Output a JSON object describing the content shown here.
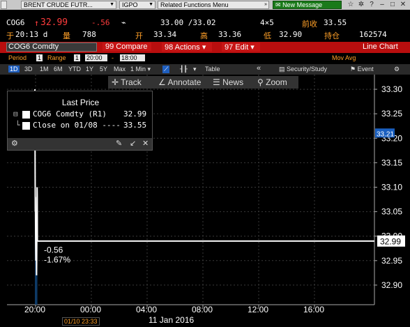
{
  "toolbar": {
    "security_dropdown": "BRENT CRUDE FUTR...",
    "igpo": "IGPO",
    "related": "Related Functions  Menu",
    "message": "New Message"
  },
  "quote": {
    "ticker": "COG6",
    "arrow": "↑",
    "last": "32.99",
    "change": "-.56",
    "bid_ask": "33.00 /33.02",
    "size": "4×5",
    "prev_close_label": "前收",
    "prev_close": "33.55",
    "time_label": "于",
    "time": "20:13 d",
    "volume_label": "量",
    "volume": "788",
    "open_label": "开",
    "open": "33.34",
    "high_label": "高",
    "high": "33.36",
    "low_label": "低",
    "low": "32.90",
    "oi_label": "持仓",
    "oi": "162574"
  },
  "function_bar": {
    "security": "COG6 Comdty",
    "compare": "99 Compare",
    "actions": "98 Actions",
    "edit": "97 Edit",
    "view": "Line Chart"
  },
  "period_row": {
    "period_label": "Period",
    "period_value": "1",
    "range_label": "Range",
    "range_value": "1",
    "start": "20:00",
    "sep": "-",
    "end": "18:00",
    "mov_avg": "Mov Avg"
  },
  "interval_row": {
    "items": [
      "1D",
      "3D",
      "1M",
      "6M",
      "YTD",
      "1Y",
      "5Y",
      "Max",
      "1 Min"
    ],
    "table": "Table",
    "security_study": "Security/Study",
    "event": "Event"
  },
  "chart_tools": {
    "track": "Track",
    "annotate": "Annotate",
    "news": "News",
    "zoom": "Zoom"
  },
  "legend": {
    "title": "Last Price",
    "rows": [
      {
        "name": "COG6 Comdty  (R1)",
        "value": "32.99"
      },
      {
        "name": "Close on 01/08 ----",
        "value": "33.55"
      }
    ]
  },
  "chart_data": {
    "type": "line",
    "x_ticks": [
      "20:00",
      "00:00",
      "04:00",
      "08:00",
      "12:00",
      "16:00"
    ],
    "y_ticks": [
      32.9,
      32.95,
      33.0,
      33.05,
      33.1,
      33.15,
      33.2,
      33.25,
      33.3
    ],
    "ylim": [
      32.86,
      33.33
    ],
    "last_value": "32.99",
    "marker_value": "33.21",
    "change_abs": "-0.56",
    "change_pct": "-1.67%",
    "date_tag": "01/10 23:33",
    "date_main": "11 Jan 2016",
    "series": [
      {
        "values": [
          [
            19.95,
            33.3
          ],
          [
            19.96,
            33.22
          ],
          [
            19.97,
            33.12
          ],
          [
            19.98,
            33.05
          ],
          [
            19.99,
            33.08
          ],
          [
            20.0,
            33.02
          ],
          [
            20.01,
            32.98
          ],
          [
            20.02,
            32.95
          ],
          [
            20.03,
            32.98
          ],
          [
            20.04,
            33.02
          ],
          [
            20.05,
            33.0
          ],
          [
            20.06,
            32.97
          ],
          [
            20.07,
            32.92
          ],
          [
            20.08,
            32.95
          ],
          [
            20.09,
            32.99
          ],
          [
            20.1,
            33.04
          ],
          [
            20.11,
            33.1
          ],
          [
            20.12,
            33.08
          ],
          [
            20.13,
            32.99
          ]
        ]
      }
    ]
  }
}
